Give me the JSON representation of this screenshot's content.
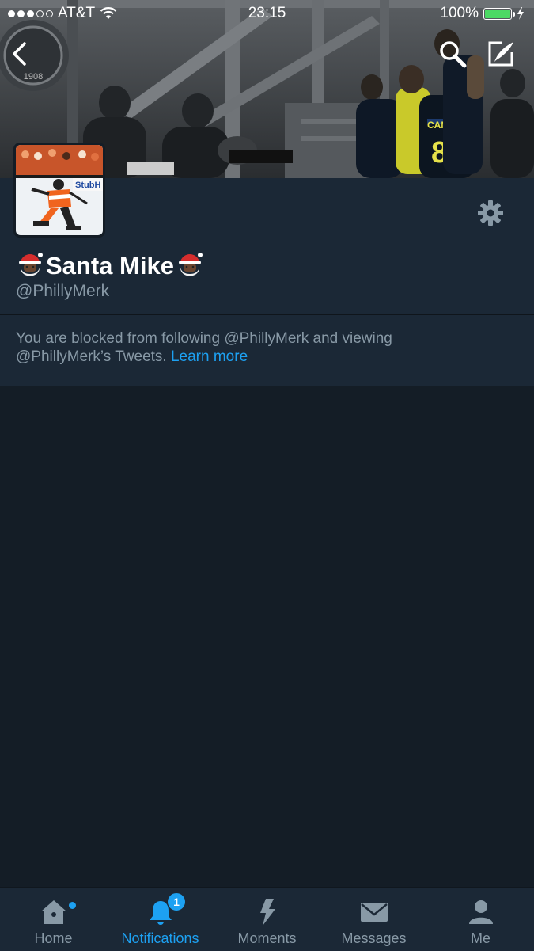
{
  "status_bar": {
    "carrier": "AT&T",
    "time": "23:15",
    "battery": "100%"
  },
  "profile": {
    "display_name": "Santa Mike",
    "handle": "@PhillyMerk",
    "blocked_text": "You are blocked from following @PhillyMerk and viewing @PhillyMerk’s Tweets.",
    "learn_more": "Learn more",
    "avatar_sign": "StubH"
  },
  "banner": {
    "crest_year": "1908",
    "jersey_name": "CANDREVA",
    "jersey_number": "87"
  },
  "tabs": [
    {
      "label": "Home",
      "icon": "home-icon"
    },
    {
      "label": "Notifications",
      "icon": "bell-icon",
      "badge": "1"
    },
    {
      "label": "Moments",
      "icon": "lightning-icon"
    },
    {
      "label": "Messages",
      "icon": "envelope-icon"
    },
    {
      "label": "Me",
      "icon": "person-icon"
    }
  ],
  "colors": {
    "background": "#141d26",
    "panel": "#1b2836",
    "accent": "#1da1f2",
    "muted": "#8899a6"
  }
}
